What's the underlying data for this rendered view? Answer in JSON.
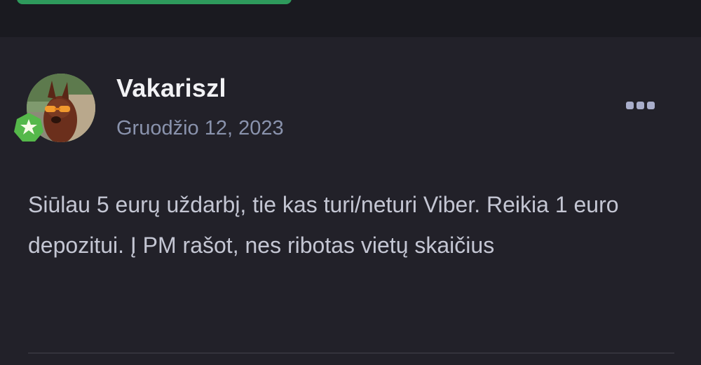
{
  "post": {
    "username": "Vakariszl",
    "date": "Gruodžio 12, 2023",
    "body": "Siūlau 5 eurų uždarbį, tie kas turi/neturi Viber. Reikia 1 euro depozitui. Į PM rašot, nes ribotas vietų skaičius",
    "more_icon": "ellipsis-icon",
    "badge_icon": "star-badge-icon"
  },
  "colors": {
    "background": "#222129",
    "top_bar": "#1a1a20",
    "accent_green": "#2e9a5c",
    "username": "#f2f2f5",
    "date": "#8a93ad",
    "body_text": "#c4c6d3"
  }
}
